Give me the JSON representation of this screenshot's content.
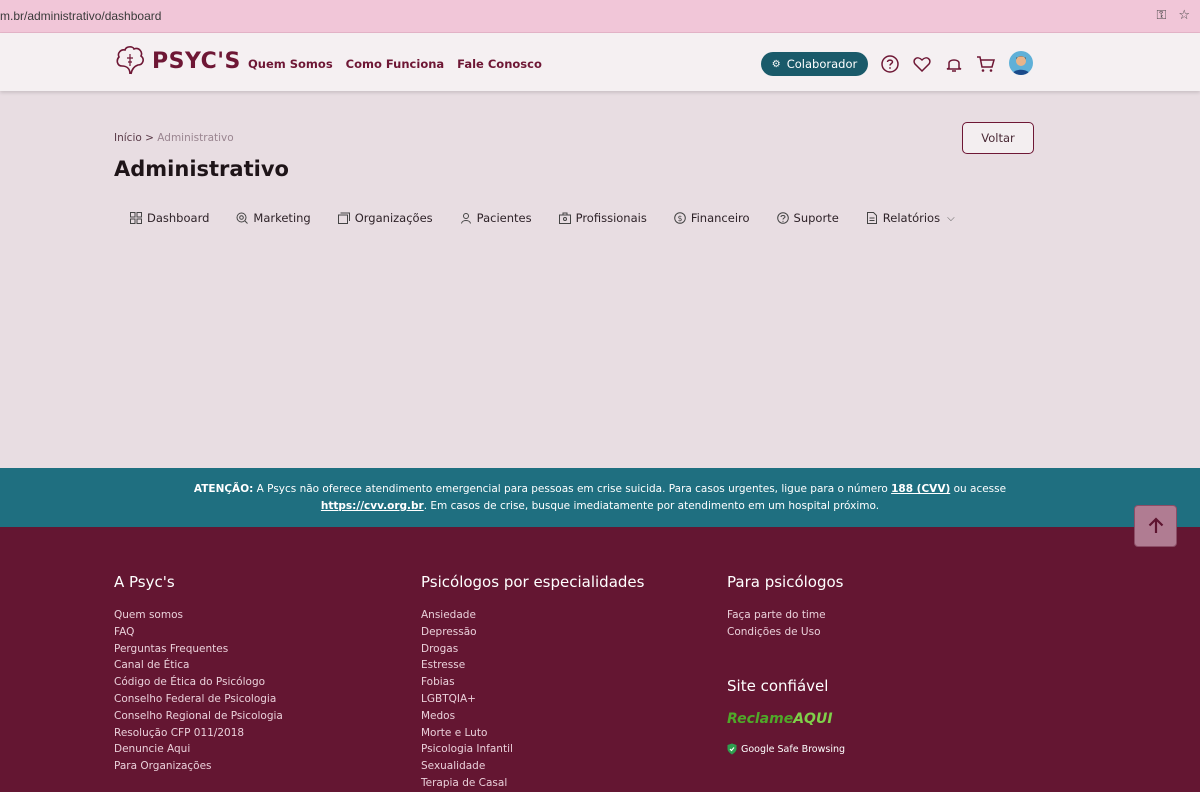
{
  "browser": {
    "url": "m.br/administrativo/dashboard"
  },
  "header": {
    "brand": "PSYC'S",
    "nav": [
      "Quem Somos",
      "Como Funciona",
      "Fale Conosco"
    ],
    "colaborador_label": "Colaborador"
  },
  "main": {
    "breadcrumb_home": "Início",
    "breadcrumb_sep": " > ",
    "breadcrumb_current": "Administrativo",
    "title": "Administrativo",
    "voltar_label": "Voltar",
    "tabs": [
      {
        "label": "Dashboard",
        "icon": "dashboard-icon"
      },
      {
        "label": "Marketing",
        "icon": "marketing-icon"
      },
      {
        "label": "Organizações",
        "icon": "organizations-icon"
      },
      {
        "label": "Pacientes",
        "icon": "patients-icon"
      },
      {
        "label": "Profissionais",
        "icon": "professionals-icon"
      },
      {
        "label": "Financeiro",
        "icon": "finance-icon"
      },
      {
        "label": "Suporte",
        "icon": "support-icon"
      },
      {
        "label": "Relatórios",
        "icon": "reports-icon"
      }
    ]
  },
  "warning": {
    "label": "ATENÇÃO:",
    "text1": " A Psycs não oferece atendimento emergencial para pessoas em crise suicida. Para casos urgentes, ligue para o número ",
    "phone": "188 (CVV)",
    "text2": " ou acesse",
    "link": "https://cvv.org.br",
    "text3": ". Em casos de crise, busque imediatamente por atendimento em um hospital próximo."
  },
  "footer": {
    "col1": {
      "title": "A Psyc's",
      "links": [
        "Quem somos",
        "FAQ",
        "Perguntas Frequentes",
        "Canal de Ética",
        "Código de Ética do Psicólogo",
        "Conselho Federal de Psicologia",
        "Conselho Regional de Psicologia",
        "Resolução CFP 011/2018",
        "Denuncie Aqui",
        "Para Organizações"
      ]
    },
    "col2": {
      "title": "Psicólogos por especialidades",
      "links": [
        "Ansiedade",
        "Depressão",
        "Drogas",
        "Estresse",
        "Fobias",
        "LGBTQIA+",
        "Medos",
        "Morte e Luto",
        "Psicologia Infantil",
        "Sexualidade",
        "Terapia de Casal"
      ]
    },
    "col3": {
      "title": "Para psicólogos",
      "links": [
        "Faça parte do time",
        "Condições de Uso"
      ],
      "trust_title": "Site confiável",
      "reclame_a": "Reclame",
      "reclame_b": "AQUI",
      "gsb": "Google Safe Browsing"
    }
  },
  "colors": {
    "brand": "#6e1735",
    "teal": "#1f6f80",
    "footer": "#641632"
  }
}
